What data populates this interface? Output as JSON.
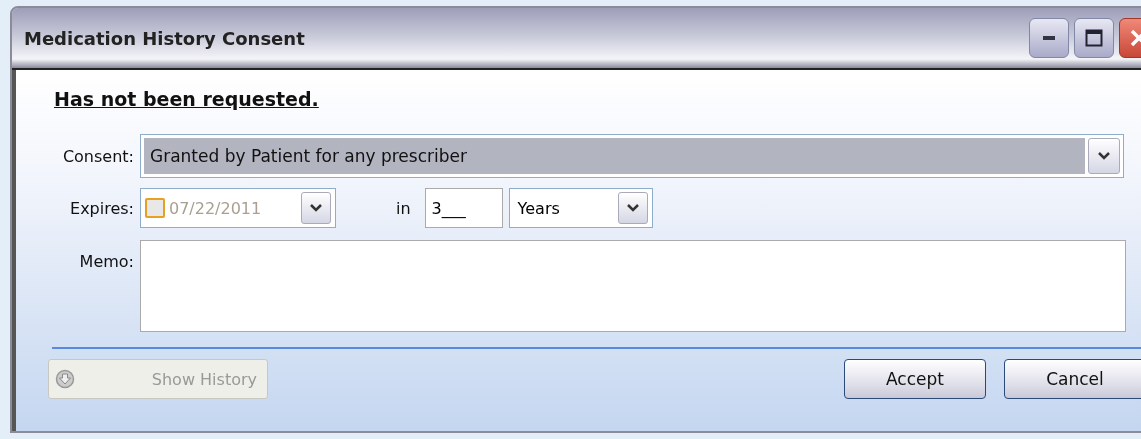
{
  "window": {
    "title": "Medication History Consent"
  },
  "status": "Has not been requested.",
  "consent": {
    "label": "Consent:",
    "value": "Granted by Patient for any prescriber"
  },
  "expires": {
    "label": "Expires:",
    "date": "07/22/2011",
    "date_enabled": false,
    "in_label": "in",
    "count": "3___",
    "unit": "Years"
  },
  "memo": {
    "label": "Memo:"
  },
  "buttons": [
    {
      "label": "Show History",
      "kind": "history",
      "disabled": true
    },
    {
      "label": "Accept",
      "kind": "plain",
      "disabled": false
    },
    {
      "label": "Cancel",
      "kind": "plain",
      "disabled": false
    }
  ]
}
